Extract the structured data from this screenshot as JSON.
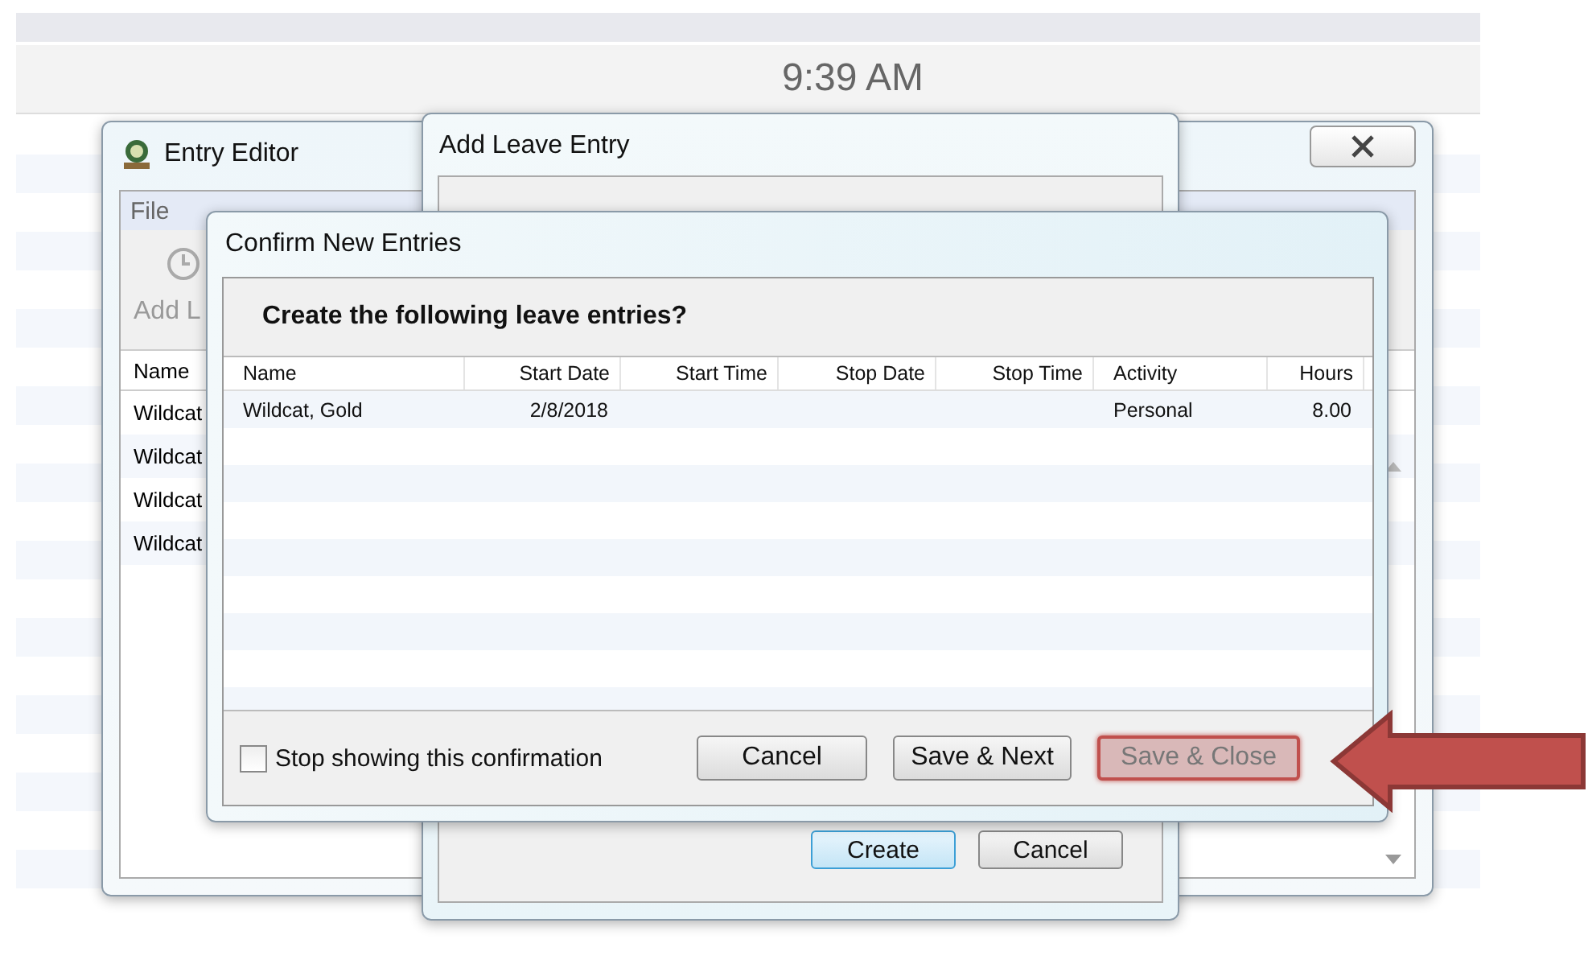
{
  "clock": "9:39 AM",
  "entry_editor": {
    "title": "Entry Editor",
    "menu": [
      "File"
    ],
    "toolbar": [
      "Add L"
    ],
    "columns": [
      "Name"
    ],
    "rows": [
      "Wildcat",
      "Wildcat",
      "Wildcat",
      "Wildcat"
    ]
  },
  "add_leave_entry": {
    "title": "Add Leave Entry",
    "buttons": [
      {
        "label": "Create",
        "selected": true
      },
      {
        "label": "Cancel",
        "selected": false
      }
    ]
  },
  "confirm": {
    "title": "Confirm New Entries",
    "heading": "Create the following leave entries?",
    "columns": [
      "Name",
      "Start Date",
      "Start Time",
      "Stop Date",
      "Stop Time",
      "Activity",
      "Hours"
    ],
    "rows": [
      {
        "name": "Wildcat, Gold",
        "start_date": "2/8/2018",
        "activity": "Personal",
        "hours": "8.00"
      }
    ],
    "stop_showing": {
      "label": "Stop showing this confirmation",
      "checked": false
    },
    "buttons": [
      {
        "label": "Cancel",
        "highlighted": false
      },
      {
        "label": "Save & Next",
        "highlighted": false
      },
      {
        "label": "Save & Close",
        "highlighted": true
      }
    ]
  }
}
